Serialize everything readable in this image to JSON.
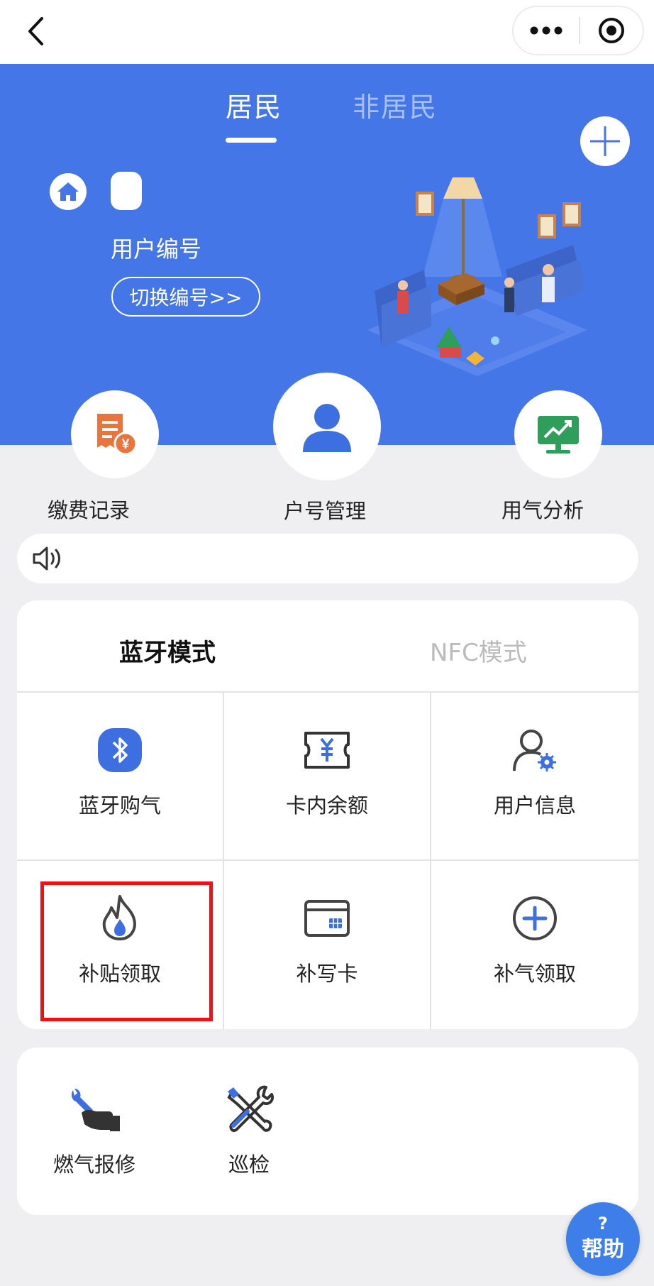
{
  "header": {
    "tabs": [
      {
        "label": "居民",
        "active": true
      },
      {
        "label": "非居民",
        "active": false
      }
    ],
    "account_label": "用户编号",
    "switch_button": "切换编号>>"
  },
  "quick_actions": [
    {
      "label": "缴费记录",
      "icon": "receipt-yen-icon"
    },
    {
      "label": "户号管理",
      "icon": "user-avatar-icon"
    },
    {
      "label": "用气分析",
      "icon": "trend-chart-icon"
    }
  ],
  "notice": {
    "icon": "speaker-icon",
    "text": ""
  },
  "mode": {
    "tabs": [
      {
        "label": "蓝牙模式",
        "active": true
      },
      {
        "label": "NFC模式",
        "active": false
      }
    ],
    "items": [
      {
        "label": "蓝牙购气",
        "icon": "bluetooth-icon"
      },
      {
        "label": "卡内余额",
        "icon": "yen-ticket-icon"
      },
      {
        "label": "用户信息",
        "icon": "user-settings-icon"
      },
      {
        "label": "补贴领取",
        "icon": "flame-icon",
        "highlighted": true
      },
      {
        "label": "补写卡",
        "icon": "card-icon"
      },
      {
        "label": "补气领取",
        "icon": "plus-circle-icon"
      }
    ]
  },
  "services": [
    {
      "label": "燃气报修",
      "icon": "repair-hand-icon"
    },
    {
      "label": "巡检",
      "icon": "tools-icon"
    }
  ],
  "help": {
    "mark": "?",
    "label": "帮助"
  },
  "colors": {
    "primary": "#4476e8",
    "highlight": "#e8141a",
    "help_bg": "#3e7ee9"
  }
}
